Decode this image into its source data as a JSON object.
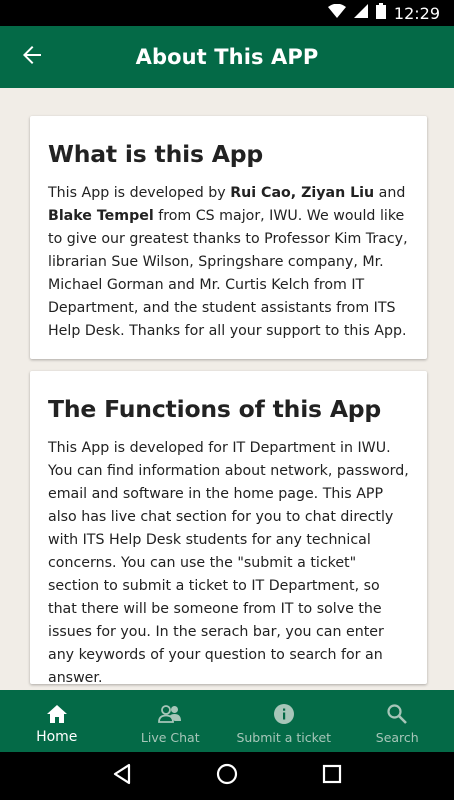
{
  "status_bar": {
    "time": "12:29"
  },
  "app_bar": {
    "title": "About This APP"
  },
  "cards": [
    {
      "title": "What is this App",
      "body_parts": [
        "This App is developed by ",
        "Rui Cao, Ziyan Liu",
        " and ",
        "Blake Tempel",
        " from CS major, IWU. We would like to give our greatest thanks to Professor Kim Tracy, librarian Sue Wilson, Springshare company, Mr. Michael Gorman and Mr. Curtis Kelch from IT Department, and the student assistants from ITS Help Desk. Thanks for all your support to this App."
      ]
    },
    {
      "title": "The Functions of this App",
      "body": "This App is developed for IT Department in IWU. You can find information about network, password, email and software in the home page. This APP also has live chat section for you to chat directly with ITS Help Desk students for any technical concerns. You can use the \"submit a ticket\" section to submit a ticket to IT Department, so that there will be someone from IT to solve the issues for you. In the serach bar, you can enter any keywords of your question to search for an answer."
    }
  ],
  "bottom_nav": {
    "items": [
      {
        "label": "Home",
        "icon": "home-icon",
        "active": true
      },
      {
        "label": "Live Chat",
        "icon": "people-icon",
        "active": false
      },
      {
        "label": "Submit a ticket",
        "icon": "info-icon",
        "active": false
      },
      {
        "label": "Search",
        "icon": "search-icon",
        "active": false
      }
    ]
  },
  "colors": {
    "primary": "#046a47",
    "background": "#f1ede7",
    "nav_inactive": "#a7c6b9"
  }
}
